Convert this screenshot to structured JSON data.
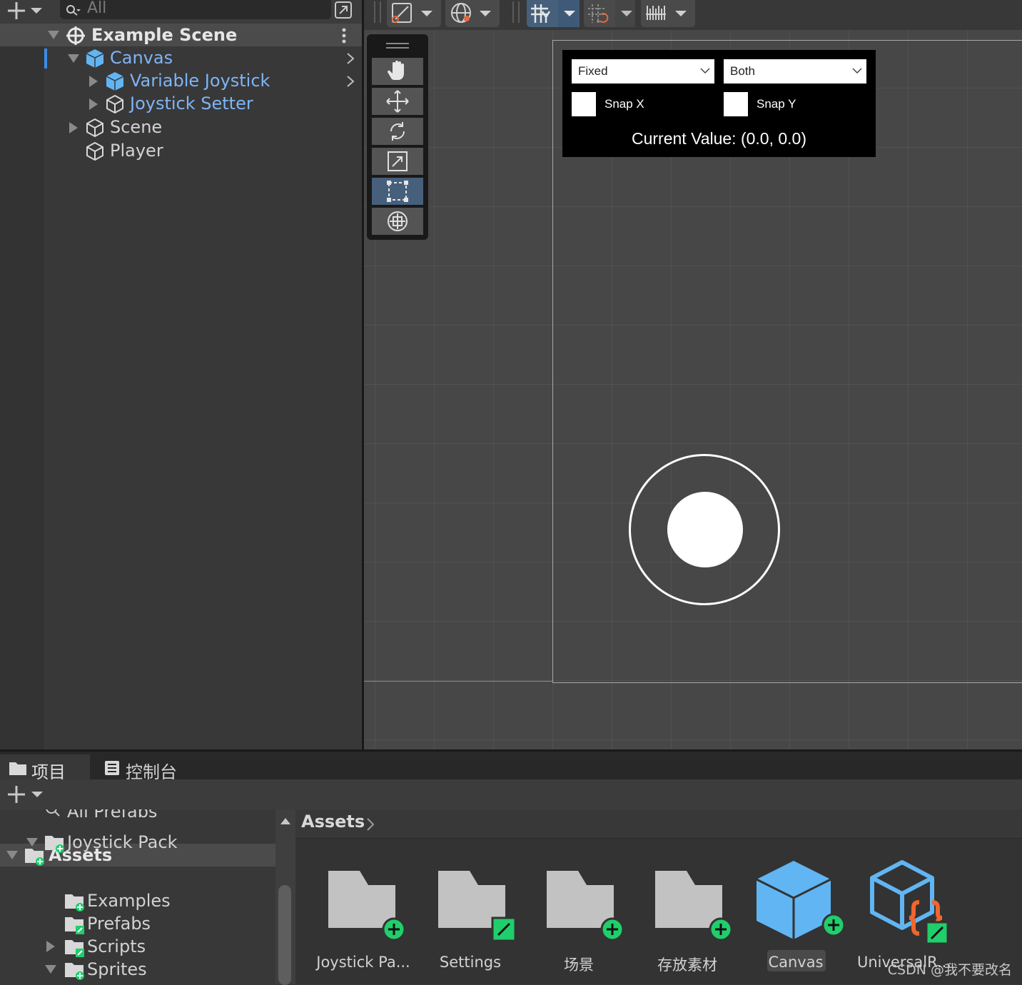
{
  "hierarchy": {
    "search_placeholder": "All",
    "scene_name": "Example Scene",
    "items": [
      {
        "label": "Canvas",
        "selected_color": "blue"
      },
      {
        "label": "Variable Joystick"
      },
      {
        "label": "Joystick Setter"
      },
      {
        "label": "Scene"
      },
      {
        "label": "Player"
      }
    ]
  },
  "scene_ui": {
    "dropdown_left": "Fixed",
    "dropdown_right": "Both",
    "snap_x": "Snap X",
    "snap_y": "Snap Y",
    "current_value": "Current Value: (0.0, 0.0)"
  },
  "bottom": {
    "tabs": [
      "项目",
      "控制台"
    ],
    "search_label": "All Prefabs",
    "folder_tree": [
      {
        "label": "Assets"
      },
      {
        "label": "Joystick Pack"
      },
      {
        "label": "Examples"
      },
      {
        "label": "Prefabs"
      },
      {
        "label": "Scripts"
      },
      {
        "label": "Sprites"
      }
    ],
    "breadcrumb": "Assets",
    "files": [
      {
        "label": "Joystick Pa..."
      },
      {
        "label": "Settings"
      },
      {
        "label": "场景"
      },
      {
        "label": "存放素材"
      },
      {
        "label": "Canvas"
      },
      {
        "label": "UniversalR..."
      }
    ]
  },
  "watermark": "CSDN @我不要改名",
  "colors": {
    "accent_blue": "#7fb4f5",
    "active_tool": "#46607c",
    "badge_green": "#1fcf6b",
    "prefab_blue": "#61b5f2"
  }
}
